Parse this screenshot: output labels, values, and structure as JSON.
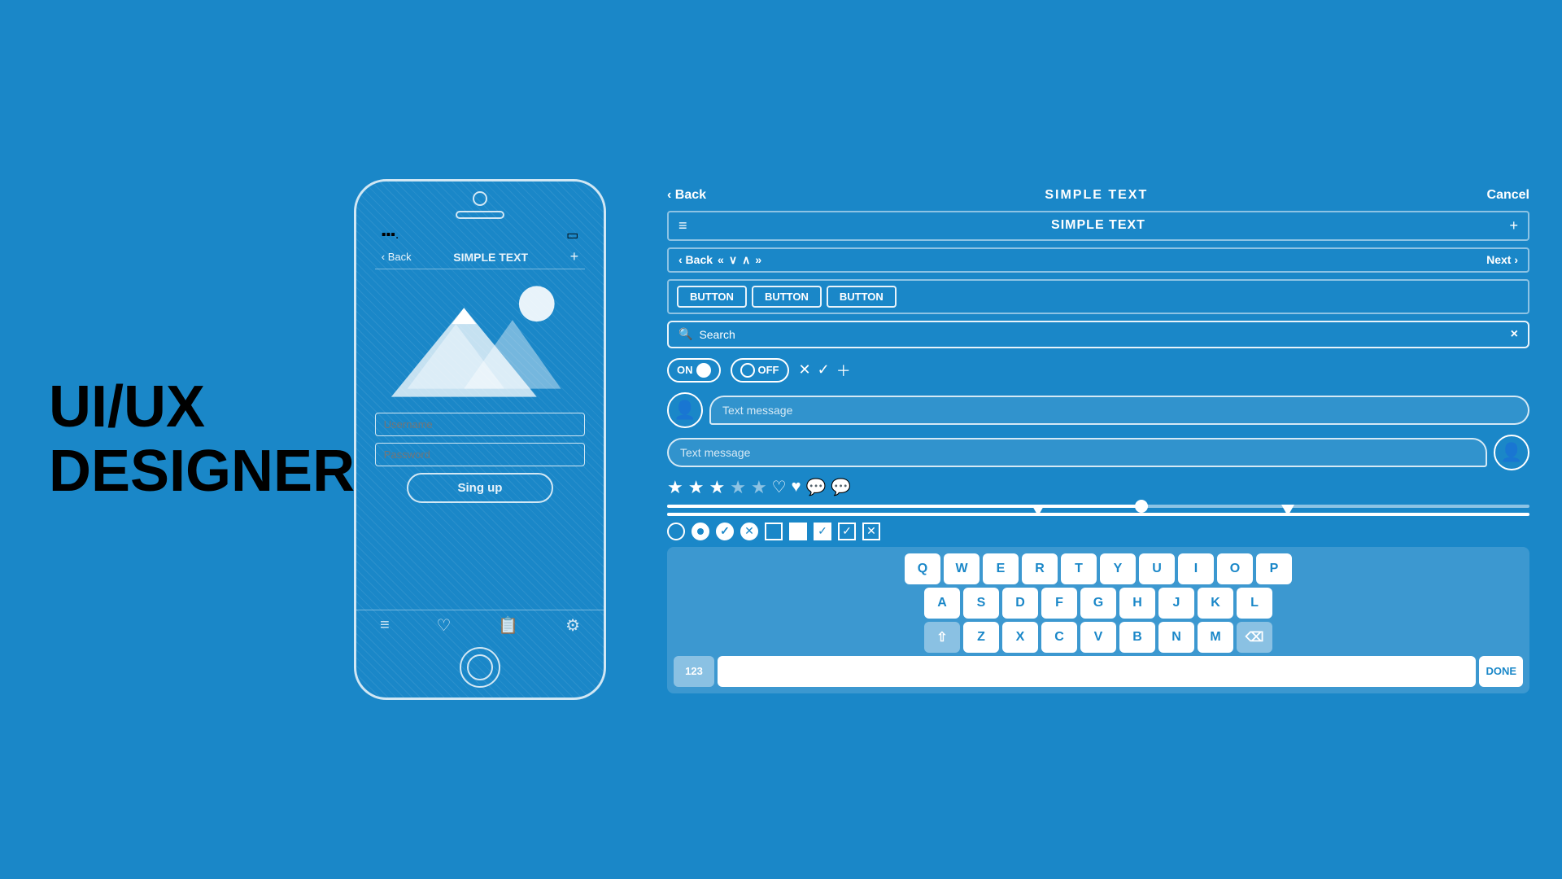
{
  "title": {
    "line1": "UI/UX",
    "line2": "DESIGNER"
  },
  "phone": {
    "signal": "▪▪▪.",
    "battery": "▭",
    "nav": {
      "back": "‹ Back",
      "title": "SIMPLE TEXT",
      "plus": "+"
    },
    "image_alt": "mountains illustration",
    "username_placeholder": "Username",
    "password_placeholder": "Password",
    "signup_btn": "Sing up",
    "bottom_icons": [
      "≡",
      "♡",
      "≣⁺",
      "⚙"
    ]
  },
  "ui_kit": {
    "top_nav": {
      "back": "‹ Back",
      "title": "SIMPLE TEXT",
      "cancel": "Cancel"
    },
    "toolbar": {
      "menu_icon": "≡",
      "title": "SIMPLE TEXT",
      "plus": "+"
    },
    "nav_arrows": {
      "back": "‹ Back",
      "prev_double": "«",
      "prev": "∨",
      "next_up": "∧",
      "next_double": "»",
      "next": "Next ›"
    },
    "buttons": [
      "BUTTON",
      "BUTTON",
      "BUTTON"
    ],
    "search": {
      "placeholder": "Search",
      "clear": "×"
    },
    "toggles": {
      "on_label": "ON",
      "off_label": "OFF"
    },
    "messages": {
      "left": "Text message",
      "right": "Text message"
    },
    "keyboard": {
      "row1": [
        "Q",
        "W",
        "E",
        "R",
        "T",
        "Y",
        "U",
        "I",
        "O",
        "P"
      ],
      "row2": [
        "A",
        "S",
        "D",
        "F",
        "G",
        "H",
        "J",
        "K",
        "L"
      ],
      "row3_special": "⇧",
      "row3": [
        "Z",
        "X",
        "C",
        "V",
        "B",
        "N",
        "M"
      ],
      "row3_del": "⌫",
      "bottom_left": "123",
      "bottom_right": "DONE"
    }
  }
}
